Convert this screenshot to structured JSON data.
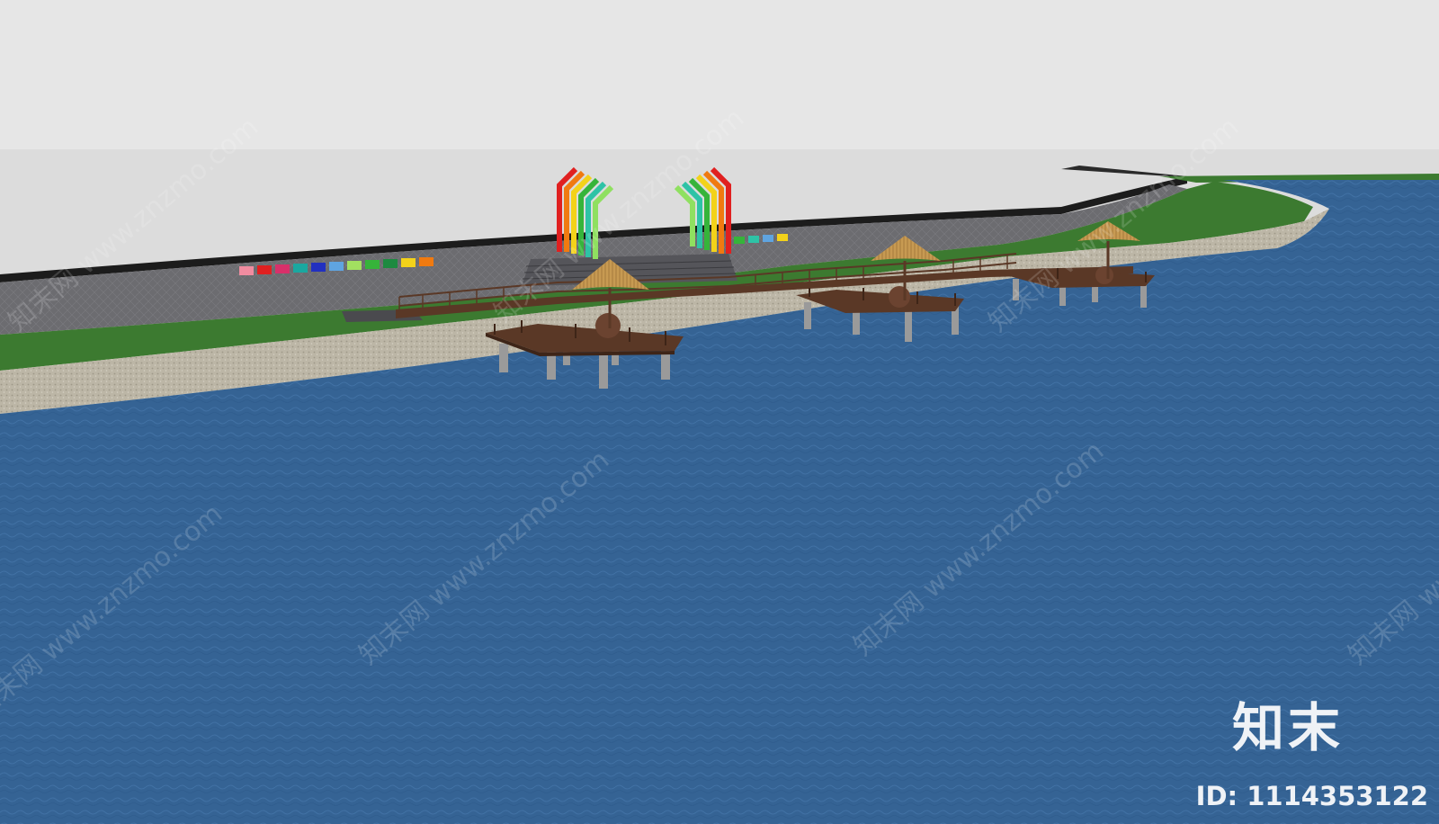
{
  "watermark": {
    "text": "知末网 www.znzmo.com",
    "brand_mark": "知末",
    "id_label": "ID: 1114353122"
  },
  "colors": {
    "sky": "#e6e6e6",
    "ground_plane": "#dcdcdc",
    "water": "#356394",
    "grass": "#3c7a30",
    "gravel": "#bcb6a6",
    "pavement": "#6c6c70",
    "wood": "#5a3826",
    "umbrella_thatch": "#c79a52",
    "arch_colors": [
      "#e02020",
      "#f07a10",
      "#f3d21a",
      "#36b43a",
      "#2ec3a6"
    ]
  },
  "scene": {
    "element_names": [
      "riverside-park-model",
      "rainbow-arch-gate",
      "wooden-viewing-platform",
      "thatched-umbrella",
      "colored-benches",
      "river-water"
    ]
  }
}
